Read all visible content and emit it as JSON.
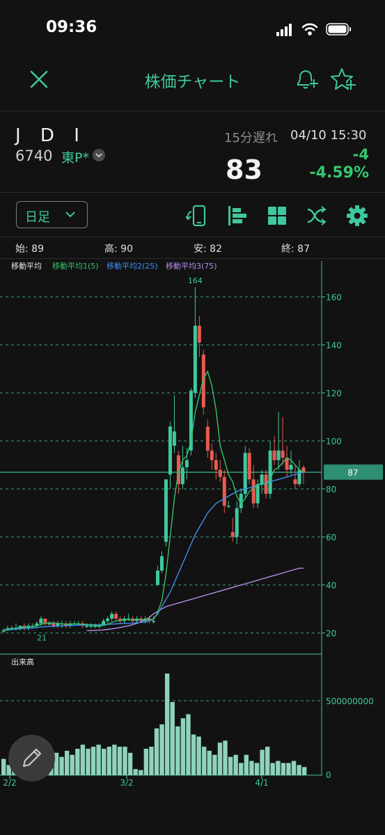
{
  "status_bar": {
    "time": "09:36"
  },
  "nav": {
    "title": "株価チャート",
    "close_icon": "close-icon",
    "alert_icon": "bell-plus-icon",
    "favorite_icon": "star-plus-icon"
  },
  "stock": {
    "name": "J D I",
    "code": "6740",
    "market": "東P*",
    "delay": "15分遅れ",
    "datetime": "04/10 15:30",
    "price": "83",
    "change": "-4",
    "change_pct": "-4.59%"
  },
  "toolbar": {
    "period": "日足",
    "icons": [
      "rotate-phone-icon",
      "align-left-icon",
      "grid-icon",
      "indicator-icon",
      "gear-icon"
    ]
  },
  "ohlc": {
    "open_label": "始:",
    "open": "89",
    "high_label": "高:",
    "high": "90",
    "low_label": "安:",
    "low": "82",
    "close_label": "終:",
    "close": "87"
  },
  "legend": {
    "title": "移動平均",
    "ma1": "移動平均1(5)",
    "ma2": "移動平均2(25)",
    "ma3": "移動平均3(75)"
  },
  "colors": {
    "accent": "#3fc89e",
    "up": "#3fc89e",
    "down": "#e85a4f",
    "ma1": "#35c26b",
    "ma2": "#3d8ef0",
    "ma3": "#b48ee8"
  },
  "volume_label": "出来高",
  "current_price_tag": "87",
  "chart_data": {
    "type": "candlestick",
    "price_axis": {
      "ticks": [
        20,
        40,
        60,
        80,
        100,
        120,
        140,
        160
      ],
      "range": [
        15,
        172
      ]
    },
    "volume_axis": {
      "ticks": [
        "0",
        "500000000"
      ]
    },
    "x_labels": [
      "2/2",
      "3/2",
      "4/1"
    ],
    "annotations": {
      "max": "164",
      "min": "21"
    },
    "candles": [
      {
        "o": 21,
        "h": 22,
        "l": 20,
        "c": 21
      },
      {
        "o": 21,
        "h": 23,
        "l": 21,
        "c": 22
      },
      {
        "o": 22,
        "h": 23,
        "l": 21,
        "c": 22
      },
      {
        "o": 22,
        "h": 24,
        "l": 21,
        "c": 22
      },
      {
        "o": 22,
        "h": 23,
        "l": 21,
        "c": 23
      },
      {
        "o": 23,
        "h": 24,
        "l": 21,
        "c": 22
      },
      {
        "o": 22,
        "h": 24,
        "l": 21,
        "c": 23
      },
      {
        "o": 23,
        "h": 24,
        "l": 22,
        "c": 23
      },
      {
        "o": 23,
        "h": 25,
        "l": 22,
        "c": 24
      },
      {
        "o": 24,
        "h": 27,
        "l": 23,
        "c": 26
      },
      {
        "o": 26,
        "h": 26,
        "l": 23,
        "c": 24
      },
      {
        "o": 24,
        "h": 25,
        "l": 23,
        "c": 24
      },
      {
        "o": 24,
        "h": 25,
        "l": 22,
        "c": 23
      },
      {
        "o": 23,
        "h": 25,
        "l": 22,
        "c": 24
      },
      {
        "o": 24,
        "h": 25,
        "l": 22,
        "c": 24
      },
      {
        "o": 24,
        "h": 25,
        "l": 22,
        "c": 23
      },
      {
        "o": 23,
        "h": 25,
        "l": 22,
        "c": 24
      },
      {
        "o": 24,
        "h": 25,
        "l": 23,
        "c": 24
      },
      {
        "o": 24,
        "h": 25,
        "l": 23,
        "c": 24
      },
      {
        "o": 24,
        "h": 25,
        "l": 22,
        "c": 23
      },
      {
        "o": 23,
        "h": 24,
        "l": 22,
        "c": 23
      },
      {
        "o": 23,
        "h": 24,
        "l": 22,
        "c": 23
      },
      {
        "o": 23,
        "h": 24,
        "l": 22,
        "c": 23
      },
      {
        "o": 23,
        "h": 24,
        "l": 22,
        "c": 23
      },
      {
        "o": 23,
        "h": 26,
        "l": 23,
        "c": 25
      },
      {
        "o": 25,
        "h": 27,
        "l": 24,
        "c": 26
      },
      {
        "o": 26,
        "h": 29,
        "l": 25,
        "c": 28
      },
      {
        "o": 28,
        "h": 29,
        "l": 25,
        "c": 26
      },
      {
        "o": 26,
        "h": 27,
        "l": 24,
        "c": 25
      },
      {
        "o": 25,
        "h": 27,
        "l": 24,
        "c": 26
      },
      {
        "o": 26,
        "h": 28,
        "l": 25,
        "c": 26
      },
      {
        "o": 26,
        "h": 27,
        "l": 24,
        "c": 25
      },
      {
        "o": 25,
        "h": 27,
        "l": 24,
        "c": 26
      },
      {
        "o": 26,
        "h": 27,
        "l": 25,
        "c": 25
      },
      {
        "o": 25,
        "h": 27,
        "l": 24,
        "c": 26
      },
      {
        "o": 26,
        "h": 27,
        "l": 24,
        "c": 25
      },
      {
        "o": 25,
        "h": 27,
        "l": 24,
        "c": 25
      },
      {
        "o": 40,
        "h": 48,
        "l": 40,
        "c": 46
      },
      {
        "o": 46,
        "h": 54,
        "l": 45,
        "c": 52
      },
      {
        "o": 58,
        "h": 84,
        "l": 56,
        "c": 84
      },
      {
        "o": 86,
        "h": 108,
        "l": 80,
        "c": 106
      },
      {
        "o": 98,
        "h": 119,
        "l": 95,
        "c": 104
      },
      {
        "o": 94,
        "h": 96,
        "l": 78,
        "c": 82
      },
      {
        "o": 82,
        "h": 98,
        "l": 80,
        "c": 89
      },
      {
        "o": 89,
        "h": 97,
        "l": 84,
        "c": 92
      },
      {
        "o": 96,
        "h": 122,
        "l": 94,
        "c": 121
      },
      {
        "o": 120,
        "h": 164,
        "l": 118,
        "c": 148
      },
      {
        "o": 148,
        "h": 152,
        "l": 135,
        "c": 141
      },
      {
        "o": 136,
        "h": 138,
        "l": 111,
        "c": 114
      },
      {
        "o": 106,
        "h": 109,
        "l": 93,
        "c": 96
      },
      {
        "o": 96,
        "h": 99,
        "l": 88,
        "c": 92
      },
      {
        "o": 92,
        "h": 95,
        "l": 84,
        "c": 88
      },
      {
        "o": 88,
        "h": 92,
        "l": 83,
        "c": 85
      },
      {
        "o": 85,
        "h": 88,
        "l": 70,
        "c": 73
      },
      {
        "o": 73,
        "h": 75,
        "l": 72,
        "c": 73
      },
      {
        "o": 62,
        "h": 68,
        "l": 58,
        "c": 60
      },
      {
        "o": 60,
        "h": 75,
        "l": 57,
        "c": 72
      },
      {
        "o": 72,
        "h": 80,
        "l": 70,
        "c": 78
      },
      {
        "o": 78,
        "h": 98,
        "l": 76,
        "c": 95
      },
      {
        "o": 95,
        "h": 97,
        "l": 82,
        "c": 84
      },
      {
        "o": 84,
        "h": 90,
        "l": 72,
        "c": 74
      },
      {
        "o": 74,
        "h": 84,
        "l": 72,
        "c": 82
      },
      {
        "o": 82,
        "h": 88,
        "l": 78,
        "c": 86
      },
      {
        "o": 86,
        "h": 88,
        "l": 76,
        "c": 78
      },
      {
        "o": 78,
        "h": 100,
        "l": 76,
        "c": 96
      },
      {
        "o": 96,
        "h": 102,
        "l": 90,
        "c": 92
      },
      {
        "o": 92,
        "h": 112,
        "l": 88,
        "c": 96
      },
      {
        "o": 96,
        "h": 110,
        "l": 90,
        "c": 93
      },
      {
        "o": 93,
        "h": 98,
        "l": 85,
        "c": 88
      },
      {
        "o": 88,
        "h": 96,
        "l": 86,
        "c": 90
      },
      {
        "o": 84,
        "h": 90,
        "l": 80,
        "c": 82
      },
      {
        "o": 82,
        "h": 92,
        "l": 81,
        "c": 88
      },
      {
        "o": 89,
        "h": 90,
        "l": 82,
        "c": 87
      }
    ],
    "ma1": [
      21,
      21.6,
      22,
      22,
      22.2,
      22.4,
      22.6,
      22.6,
      23,
      23.6,
      24,
      24.2,
      24.2,
      24,
      23.8,
      23.6,
      23.6,
      23.8,
      23.8,
      23.6,
      23.6,
      23.4,
      23.2,
      23,
      23.2,
      23.6,
      24.4,
      25,
      25.2,
      25.6,
      25.6,
      25.4,
      25.6,
      25.6,
      25.6,
      25.6,
      25.6,
      28.6,
      33.6,
      44.6,
      60,
      76,
      87,
      92,
      94,
      100,
      112,
      119,
      126,
      129,
      123,
      113,
      98,
      92,
      86,
      83,
      77,
      74,
      76,
      79,
      80,
      82,
      82,
      82,
      84,
      88,
      89,
      91,
      93,
      92,
      90,
      88,
      87
    ],
    "ma2": [
      21,
      21.3,
      21.5,
      21.6,
      21.8,
      21.9,
      22,
      22.1,
      22.3,
      22.5,
      22.6,
      22.7,
      22.8,
      22.9,
      23,
      23,
      23.1,
      23.2,
      23.3,
      23.3,
      23.3,
      23.4,
      23.4,
      23.4,
      23.5,
      23.6,
      23.7,
      23.8,
      23.9,
      24,
      24,
      24.1,
      24.3,
      24.4,
      24.6,
      25,
      26,
      28,
      31,
      34,
      37,
      41,
      45,
      49,
      53,
      57,
      61,
      64,
      67,
      70,
      72,
      74,
      75,
      76,
      77,
      78,
      79,
      79.5,
      80,
      80.5,
      81,
      81.5,
      82,
      82.5,
      83,
      83.5,
      84,
      84.5,
      85,
      85.5,
      86,
      86.5,
      87
    ],
    "ma3": [
      null,
      null,
      null,
      null,
      null,
      null,
      null,
      null,
      null,
      null,
      null,
      null,
      null,
      null,
      null,
      null,
      null,
      null,
      null,
      null,
      21,
      21,
      21.1,
      21.2,
      21.3,
      21.5,
      21.7,
      22,
      22.3,
      22.7,
      23,
      23.5,
      24,
      24.7,
      25.5,
      26.5,
      28,
      29,
      30,
      31,
      31.5,
      32,
      32.5,
      33,
      33.5,
      34,
      34.5,
      35,
      35.5,
      36,
      36.5,
      37,
      37.5,
      38,
      38.5,
      39,
      39.5,
      40,
      40.5,
      41,
      41.5,
      42,
      42.5,
      43,
      43.5,
      44,
      44.5,
      45,
      45.5,
      46,
      46.5,
      47,
      47
    ],
    "volume": [
      0.16,
      0.1,
      0.12,
      0.1,
      0.09,
      0.14,
      0.08,
      0.1,
      0.12,
      0.16,
      0.22,
      0.18,
      0.24,
      0.2,
      0.26,
      0.3,
      0.26,
      0.28,
      0.3,
      0.26,
      0.28,
      0.3,
      0.28,
      0.28,
      0.22,
      0.06,
      0.05,
      0.26,
      0.28,
      0.46,
      0.5,
      1.0,
      0.72,
      0.48,
      0.56,
      0.6,
      0.4,
      0.38,
      0.28,
      0.24,
      0.2,
      0.32,
      0.34,
      0.18,
      0.2,
      0.12,
      0.2,
      0.14,
      0.12,
      0.25,
      0.28,
      0.12,
      0.14,
      0.12,
      0.12,
      0.14,
      0.1,
      0.08
    ]
  }
}
